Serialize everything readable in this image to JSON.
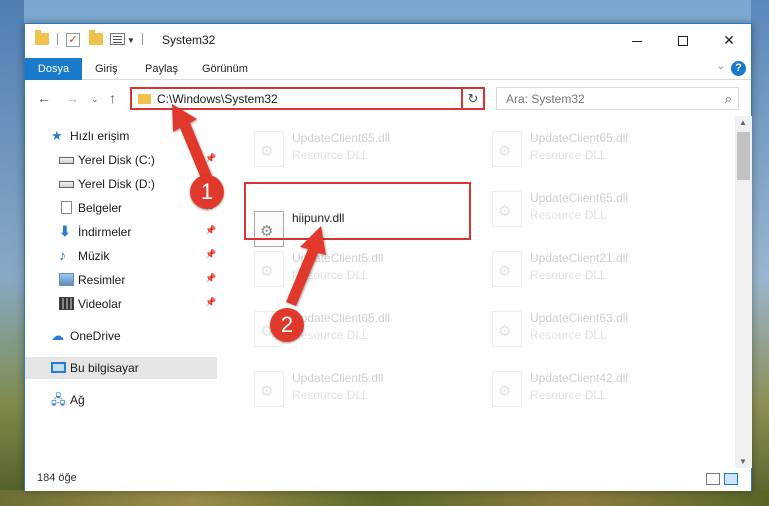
{
  "window": {
    "title": "System32",
    "controls": {
      "minimize": "",
      "maximize": "",
      "close": "✕"
    }
  },
  "ribbon": {
    "tabs": [
      "Dosya",
      "Giriş",
      "Paylaş",
      "Görünüm"
    ]
  },
  "address": {
    "path": "C:\\Windows\\System32",
    "search_placeholder": "Ara: System32"
  },
  "sidebar": {
    "items": [
      {
        "label": "Hızlı erişim",
        "icon": "star-icon"
      },
      {
        "label": "Yerel Disk (C:)",
        "icon": "drive-icon",
        "pinned": true
      },
      {
        "label": "Yerel Disk (D:)",
        "icon": "drive-icon",
        "pinned": true
      },
      {
        "label": "Belgeler",
        "icon": "documents-icon",
        "pinned": true
      },
      {
        "label": "İndirmeler",
        "icon": "download-icon",
        "pinned": true
      },
      {
        "label": "Müzik",
        "icon": "music-icon",
        "pinned": true
      },
      {
        "label": "Resimler",
        "icon": "pictures-icon",
        "pinned": true
      },
      {
        "label": "Videolar",
        "icon": "video-icon",
        "pinned": true
      },
      {
        "label": "OneDrive",
        "icon": "cloud-icon"
      },
      {
        "label": "Bu bilgisayar",
        "icon": "computer-icon",
        "selected": true
      },
      {
        "label": "Ağ",
        "icon": "network-icon"
      }
    ]
  },
  "files": [
    {
      "name": "UpdateClient65.dll",
      "type": "Resource DLL"
    },
    {
      "name": "UpdateClient65.dll",
      "type": "Resource DLL"
    },
    {
      "name": "hiipunv.dll",
      "type": "",
      "highlighted": true
    },
    {
      "name": "UpdateClient65.dll",
      "type": "Resource DLL"
    },
    {
      "name": "UpdateClient5.dll",
      "type": "Resource DLL"
    },
    {
      "name": "UpdateClient21.dll",
      "type": "Resource DLL"
    },
    {
      "name": "UpdateClient65.dll",
      "type": "Resource DLL"
    },
    {
      "name": "UpdateClient63.dll",
      "type": "Resource DLL"
    },
    {
      "name": "UpdateClient5.dll",
      "type": "Resource DLL"
    },
    {
      "name": "UpdateClient42.dll",
      "type": "Resource DLL"
    }
  ],
  "status": {
    "item_count": "184 öğe"
  },
  "callouts": {
    "step1": "1",
    "step2": "2",
    "color": "#e0392b"
  }
}
